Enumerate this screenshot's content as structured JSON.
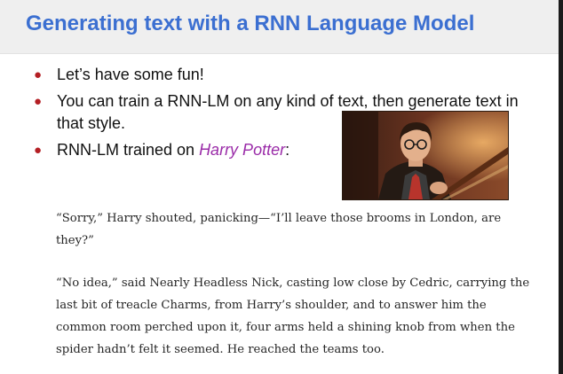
{
  "title": "Generating text with a RNN Language Model",
  "bullets": [
    {
      "text": "Let’s have some fun!"
    },
    {
      "text": "You can train a RNN-LM on any kind of text, then generate text in that style."
    },
    {
      "prefix": "RNN-LM trained on ",
      "emphasis": "Harry Potter",
      "suffix": ":"
    }
  ],
  "quotes": [
    "“Sorry,” Harry shouted, panicking—“I’ll leave those brooms in London, are they?”",
    "“No idea,” said Nearly Headless Nick, casting low close by Cedric, carrying the last bit of treacle Charms, from Harry’s shoulder, and to answer him the common room perched upon it, four arms held a shining knob from when the spider hadn’t felt it seemed. He reached the teams too."
  ],
  "colors": {
    "title": "#3b6fd1",
    "bullet_marker": "#b41f24",
    "emphasis": "#9a2ba8"
  },
  "image": {
    "subject": "Harry Potter still photo"
  }
}
